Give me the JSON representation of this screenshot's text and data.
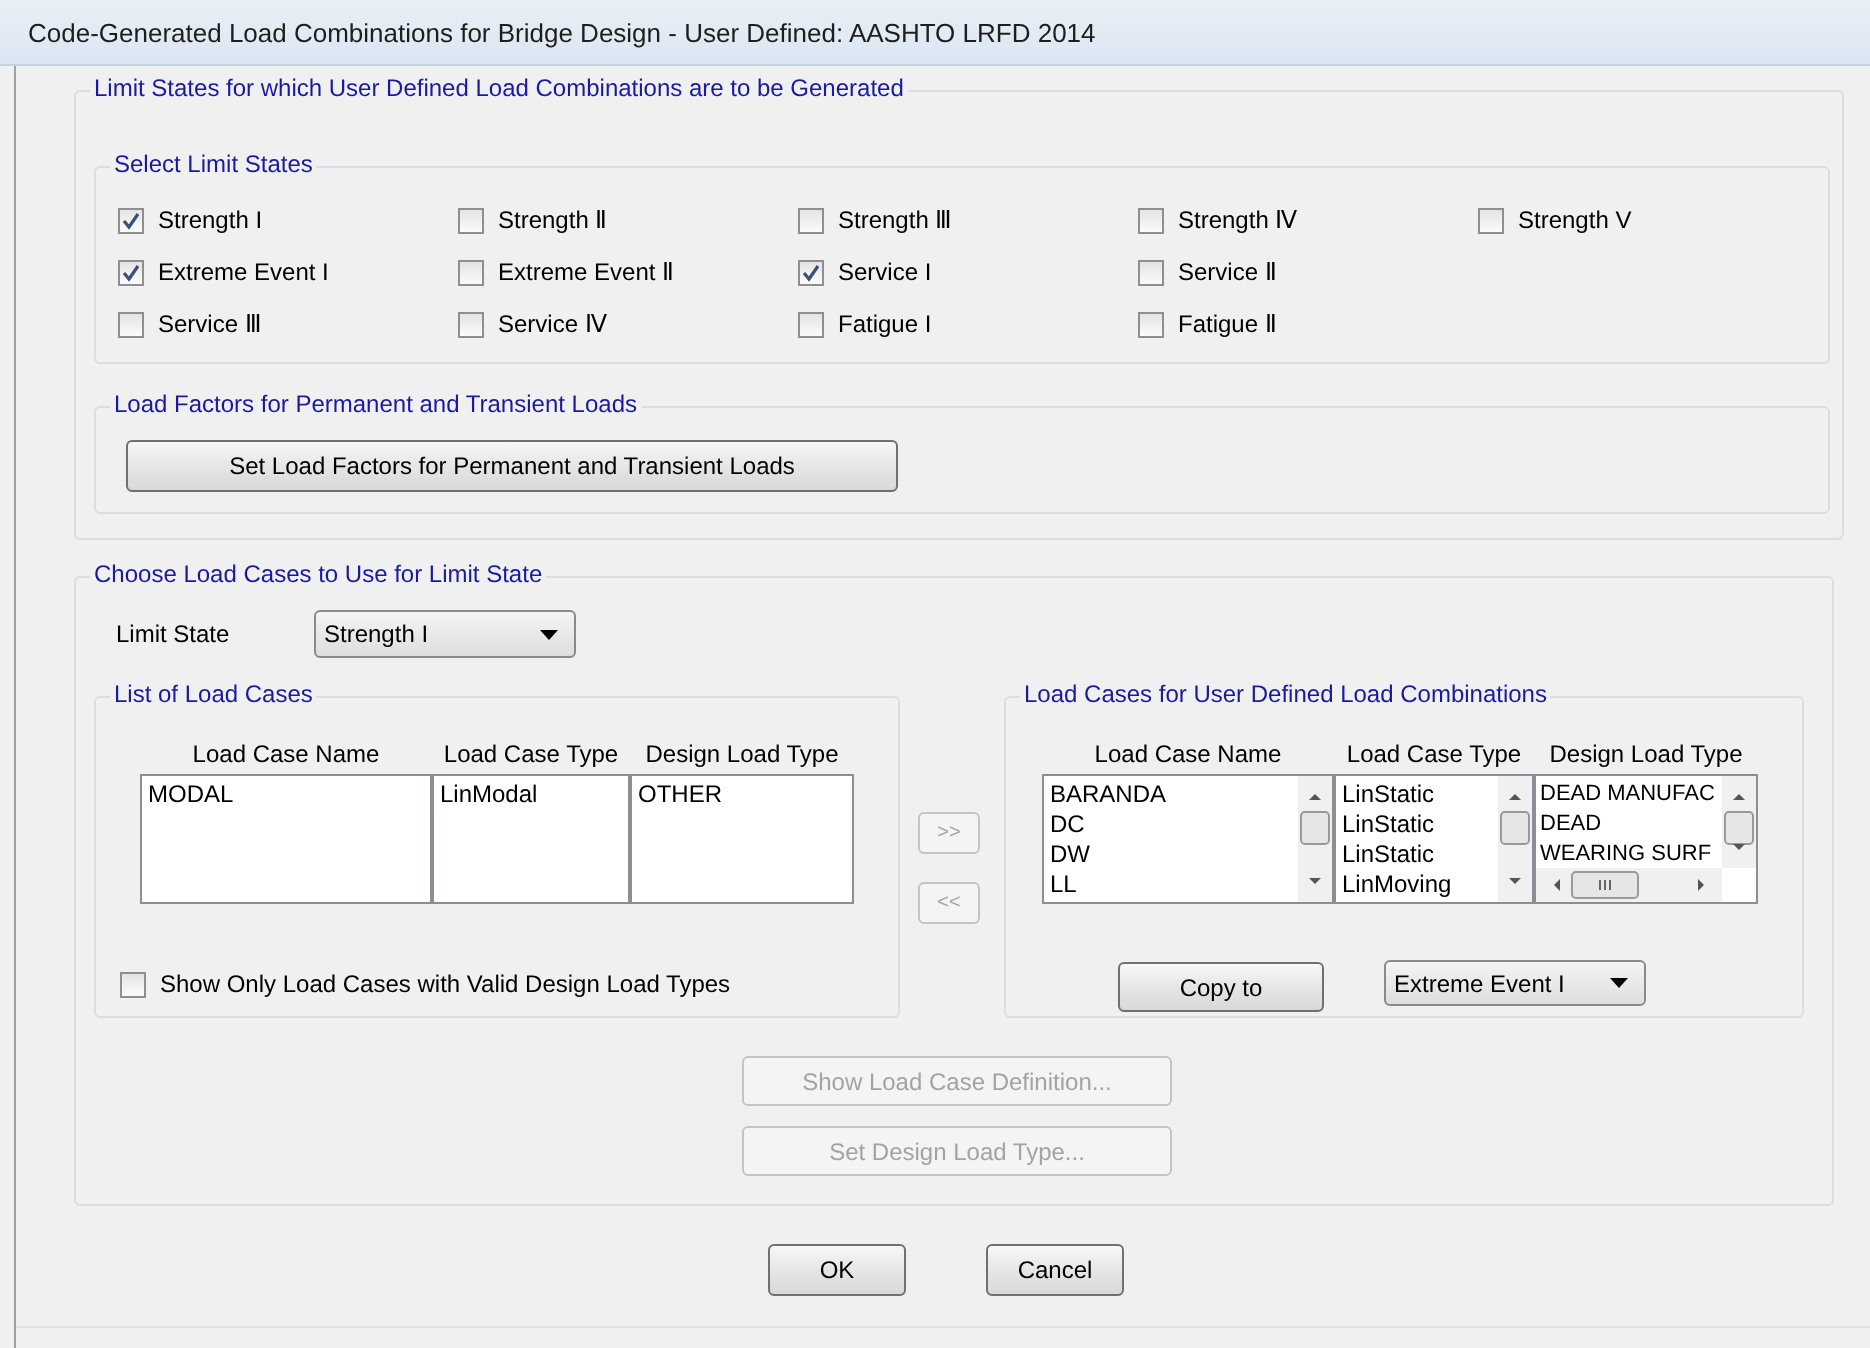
{
  "window": {
    "title": "Code-Generated Load Combinations for Bridge Design - User Defined: AASHTO LRFD 2014"
  },
  "limit_states": {
    "title": "Limit States for which User Defined Load Combinations are to be Generated",
    "select": {
      "title": "Select Limit States",
      "rows": [
        [
          {
            "label": "Strength I",
            "checked": true
          },
          {
            "label": "Strength Ⅱ",
            "checked": false
          },
          {
            "label": "Strength Ⅲ",
            "checked": false
          },
          {
            "label": "Strength Ⅳ",
            "checked": false
          },
          {
            "label": "Strength V",
            "checked": false
          }
        ],
        [
          {
            "label": "Extreme Event I",
            "checked": true
          },
          {
            "label": "Extreme Event Ⅱ",
            "checked": false
          },
          {
            "label": "Service I",
            "checked": true
          },
          {
            "label": "Service Ⅱ",
            "checked": false
          }
        ],
        [
          {
            "label": "Service Ⅲ",
            "checked": false
          },
          {
            "label": "Service Ⅳ",
            "checked": false
          },
          {
            "label": "Fatigue I",
            "checked": false
          },
          {
            "label": "Fatigue Ⅱ",
            "checked": false
          }
        ]
      ]
    },
    "load_factors": {
      "title": "Load Factors for Permanent and Transient Loads",
      "button": {
        "label": "Set Load Factors for Permanent and Transient Loads",
        "disabled": false
      }
    }
  },
  "load_cases": {
    "title": "Choose Load Cases to Use for Limit State",
    "limit_state": {
      "label": "Limit State",
      "value": "Strength I"
    },
    "available": {
      "title": "List of Load Cases",
      "columns": [
        {
          "heading": "Load Case Name",
          "cells": [
            "MODAL"
          ]
        },
        {
          "heading": "Load Case Type",
          "cells": [
            "LinModal"
          ]
        },
        {
          "heading": "Design Load Type",
          "cells": [
            "OTHER"
          ]
        }
      ],
      "show_only_valid": {
        "label": "Show Only Load Cases with Valid Design Load Types",
        "checked": false
      }
    },
    "move_buttons": [
      {
        "label": ">>",
        "disabled": true
      },
      {
        "label": "<<",
        "disabled": true
      }
    ],
    "selected": {
      "title": "Load Cases for User Defined Load Combinations",
      "columns": [
        {
          "heading": "Load Case Name",
          "cells": [
            "BARANDA",
            "DC",
            "DW",
            "LL"
          ]
        },
        {
          "heading": "Load Case Type",
          "cells": [
            "LinStatic",
            "LinStatic",
            "LinStatic",
            "LinMoving"
          ]
        },
        {
          "heading": "Design Load Type",
          "cells": [
            "DEAD MANUFAC",
            "DEAD",
            "WEARING SURF"
          ]
        }
      ],
      "copy_button": {
        "label": "Copy to",
        "disabled": false
      },
      "copy_target": {
        "value": "Extreme Event I"
      }
    },
    "actions": [
      {
        "label": "Show Load Case Definition...",
        "disabled": true
      },
      {
        "label": "Set Design Load Type...",
        "disabled": true
      }
    ]
  },
  "buttons": [
    {
      "label": "OK",
      "disabled": false
    },
    {
      "label": "Cancel",
      "disabled": false
    }
  ]
}
